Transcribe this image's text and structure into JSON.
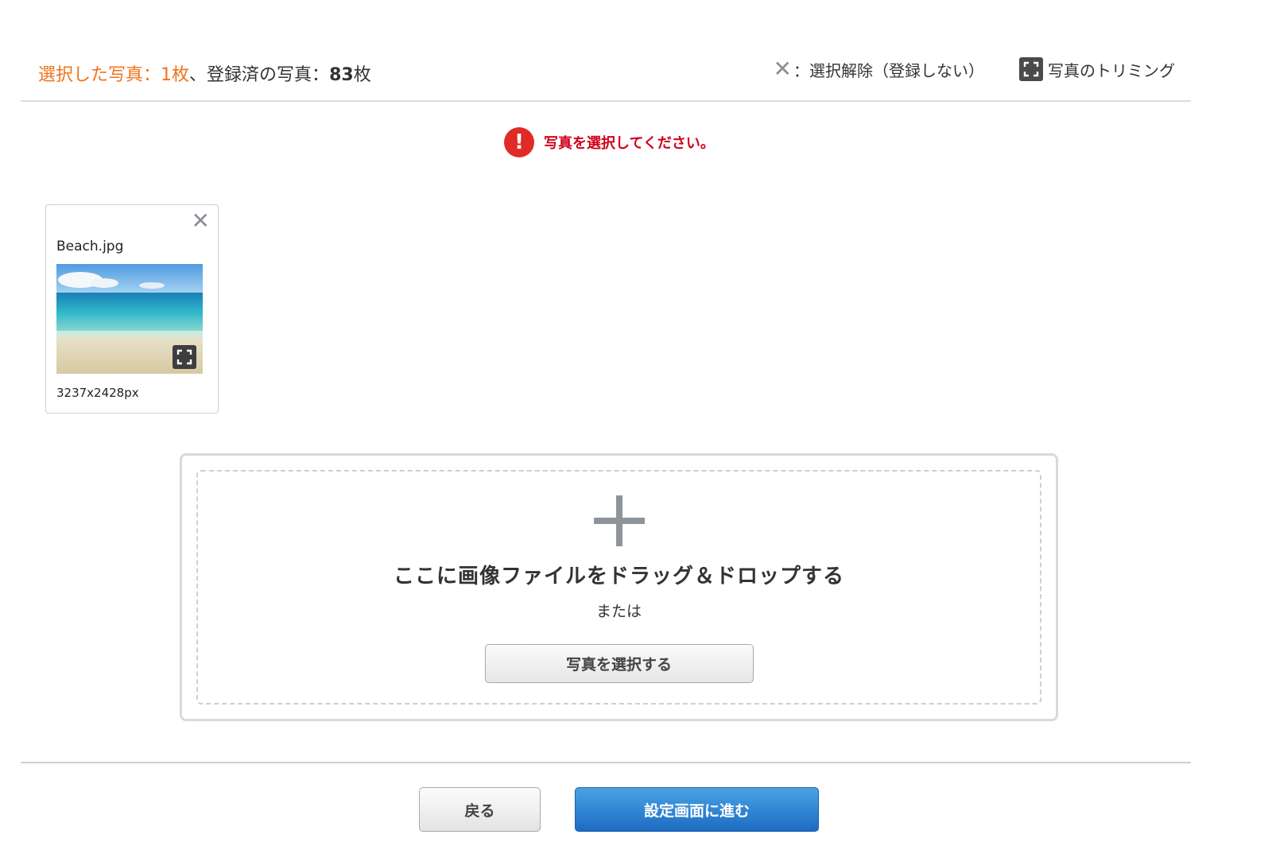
{
  "header": {
    "selected_label": "選択した写真：",
    "selected_count": "1",
    "selected_unit": "枚",
    "separator": "、",
    "registered_label": "登録済の写真：",
    "registered_count": "83",
    "registered_unit": "枚",
    "legend_remove": "：選択解除（登録しない）",
    "legend_trim": "写真のトリミング"
  },
  "error": {
    "message": "写真を選択してください。"
  },
  "photos": [
    {
      "filename": "Beach.jpg",
      "dimensions": "3237x2428px"
    }
  ],
  "dropzone": {
    "title": "ここに画像ファイルをドラッグ＆ドロップする",
    "or": "または",
    "select_button": "写真を選択する"
  },
  "footer": {
    "back_button": "戻る",
    "next_button": "設定画面に進む"
  },
  "colors": {
    "selected_accent": "#f07318",
    "error": "#d0021b",
    "primary_button": "#1c6bc2"
  },
  "icons": {
    "remove": "close-icon",
    "trim": "crop-icon",
    "error": "exclamation-icon",
    "add": "plus-icon"
  }
}
